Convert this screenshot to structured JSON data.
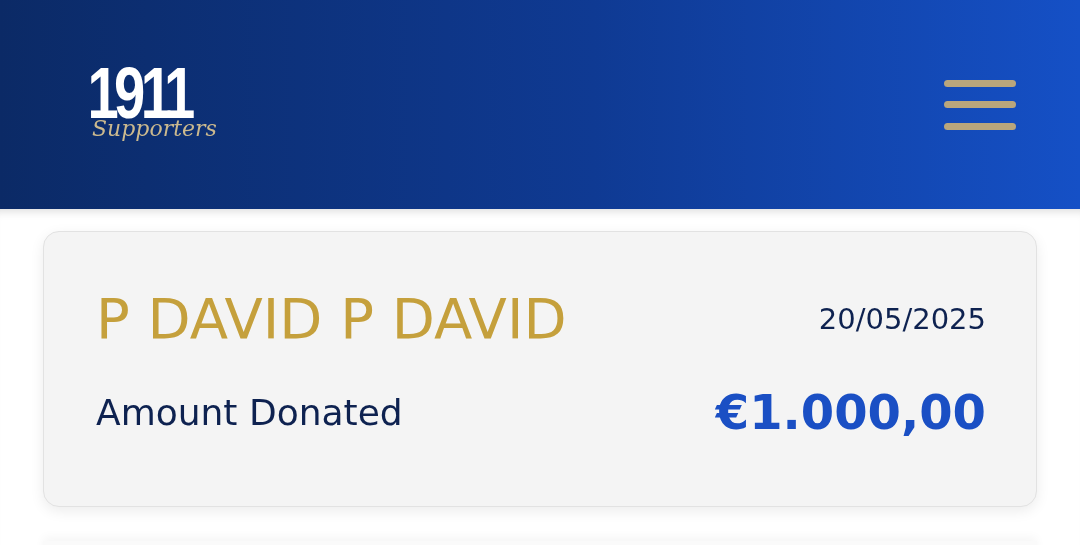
{
  "header": {
    "logo": {
      "number": "1911",
      "tagline": "Supporters"
    }
  },
  "donation": {
    "name": "P DAVID P DAVID",
    "date": "20/05/2025",
    "label": "Amount Donated",
    "amount": "€1.000,00"
  }
}
